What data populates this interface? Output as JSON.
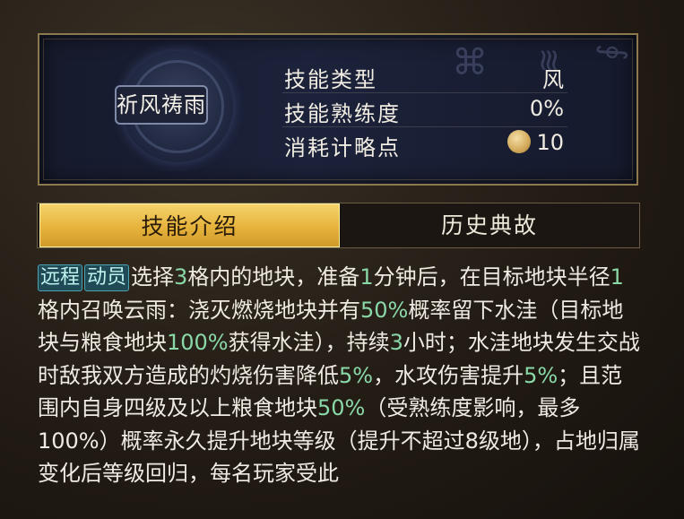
{
  "skill": {
    "name": "祈风祷雨",
    "stats": [
      {
        "label": "技能类型",
        "value": "风"
      },
      {
        "label": "技能熟练度",
        "value": "0%"
      },
      {
        "label": "消耗计略点",
        "value": "10",
        "icon": "strategy-point-icon"
      }
    ]
  },
  "tabs": [
    {
      "label": "技能介绍",
      "active": true
    },
    {
      "label": "历史典故",
      "active": false
    }
  ],
  "description": {
    "tags": [
      "远程",
      "动员"
    ],
    "segments": [
      {
        "text": "选择",
        "hl": false
      },
      {
        "text": "3",
        "hl": true
      },
      {
        "text": "格内的地块，准备",
        "hl": false
      },
      {
        "text": "1",
        "hl": true
      },
      {
        "text": "分钟后，在目标地块半径",
        "hl": false
      },
      {
        "text": "1",
        "hl": true
      },
      {
        "text": "格内召唤云雨：浇灭燃烧地块并有",
        "hl": false
      },
      {
        "text": "50%",
        "hl": true
      },
      {
        "text": "概率留下水洼（目标地块与粮食地块",
        "hl": false
      },
      {
        "text": "100%",
        "hl": true
      },
      {
        "text": "获得水洼），持续",
        "hl": false
      },
      {
        "text": "3",
        "hl": true
      },
      {
        "text": "小时；水洼地块发生交战时敌我双方造成的灼烧伤害降低",
        "hl": false
      },
      {
        "text": "5%",
        "hl": true
      },
      {
        "text": "，水攻伤害提升",
        "hl": false
      },
      {
        "text": "5%",
        "hl": true
      },
      {
        "text": "；且范围内自身四级及以上粮食地块",
        "hl": false
      },
      {
        "text": "50%",
        "hl": true
      },
      {
        "text": "（受熟练度影响，最多100%）概率永久提升地块等级（提升不超过8级地），占地归属变化后等级回归，每名玩家受此",
        "hl": false
      }
    ]
  },
  "colors": {
    "highlight": "#8ad8a8",
    "tab_active": "#e6b33c",
    "tag_bg": "#1f4a56",
    "frame": "#8c7a4e"
  }
}
